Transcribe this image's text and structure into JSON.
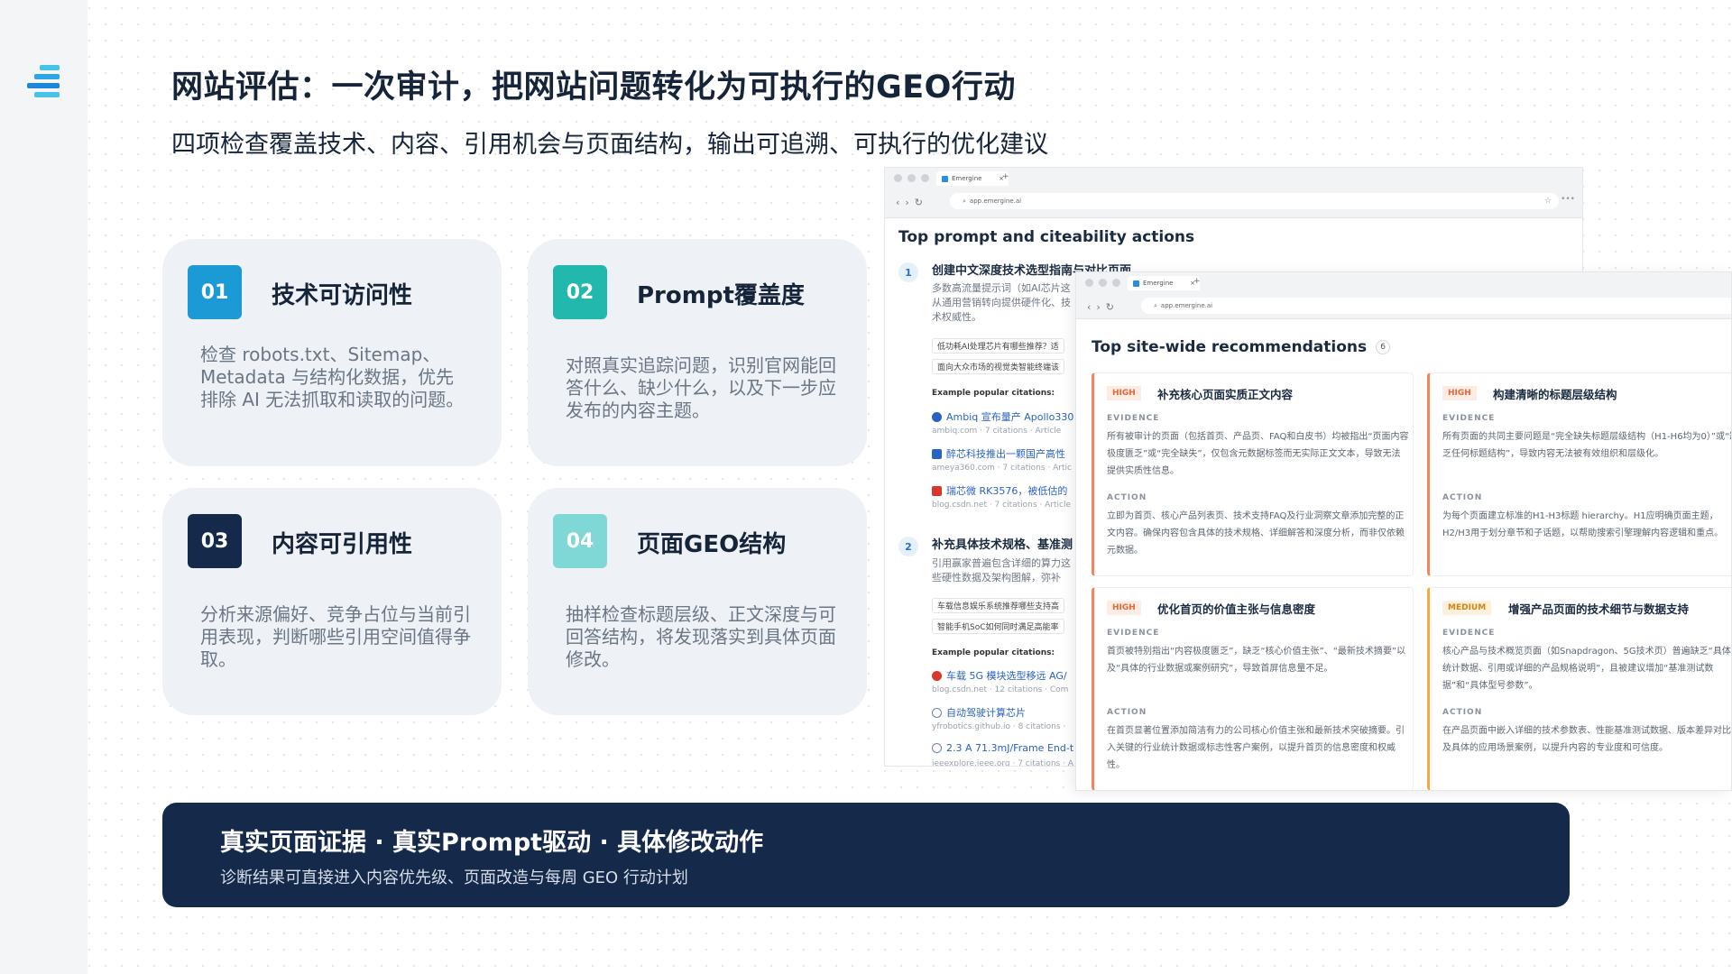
{
  "header": {
    "title": "网站评估：一次审计，把网站问题转化为可执行的GEO行动",
    "subtitle": "四项检查覆盖技术、内容、引用机会与页面结构，输出可追溯、可执行的优化建议"
  },
  "cards": [
    {
      "num": "01",
      "title": "技术可访问性",
      "desc": "检查 robots.txt、Sitemap、Metadata 与结构化数据，优先排除 AI 无法抓取和读取的问题。",
      "color": "#1b9ad6"
    },
    {
      "num": "02",
      "title": "Prompt覆盖度",
      "desc": "对照真实追踪问题，识别官网能回答什么、缺少什么，以及下一步应发布的内容主题。",
      "color": "#22b8ad"
    },
    {
      "num": "03",
      "title": "内容可引用性",
      "desc": "分析来源偏好、竞争占位与当前引用表现，判断哪些引用空间值得争取。",
      "color": "#15294a"
    },
    {
      "num": "04",
      "title": "页面GEO结构",
      "desc": "抽样检查标题层级、正文深度与可回答结构，将发现落实到具体页面修改。",
      "color": "#7fd7d6"
    }
  ],
  "browser1": {
    "tab": "Emergine",
    "url": "app.emergine.ai",
    "panel_title": "Top prompt and citeability actions",
    "items": [
      {
        "num": "1",
        "title": "创建中文深度技术选型指南与对比页面",
        "desc": "多数高流量提示词（如AI芯片这从通用营销转向提供硬件化、技术权威性。",
        "chips": [
          "低功耗AI处理芯片有哪些推荐？适",
          "面向大众市场的视觉类智能终端该"
        ],
        "label": "Example popular citations:",
        "citations": [
          {
            "title": "Ambiq 宣布量产 Apollo330",
            "meta": "ambiq.com · 7 citations · Article",
            "icon": "#2a62c4"
          },
          {
            "title": "醉芯科技推出一颗国产高性",
            "meta": "ameya360.com · 7 citations · Artic",
            "icon": "#2a62c4"
          },
          {
            "title": "瑞芯微 RK3576，被低估的",
            "meta": "blog.csdn.net · 7 citations · Article",
            "icon": "#d9372b"
          }
        ]
      },
      {
        "num": "2",
        "title": "补充具体技术规格、基准测",
        "desc": "引用赢家普遍包含详细的算力这些硬性数据及架构图解，弥补",
        "chips": [
          "车载信息娱乐系统推荐哪些支持高",
          "智能手机SoC如何同时满足高能率"
        ],
        "label": "Example popular citations:",
        "citations": [
          {
            "title": "车载 5G 模块选型移远 AG/",
            "meta": "blog.csdn.net · 12 citations · Com",
            "icon": "#d9372b"
          },
          {
            "title": "自动驾驶计算芯片",
            "meta": "yfrobotics.github.io · 8 citations ·",
            "icon": "#6e82b8"
          },
          {
            "title": "2.3 A 71.3mJ/Frame End-t",
            "meta": "ieeexplore.ieee.org · 7 citations · A",
            "icon": "#6e82b8"
          }
        ]
      }
    ]
  },
  "browser2": {
    "tab": "Emergine",
    "url": "app.emergine.ai",
    "panel_title": "Top site-wide recommendations",
    "count": "6",
    "evidence_label": "EVIDENCE",
    "action_label": "ACTION",
    "recs": [
      {
        "priority": "HIGH",
        "title": "补充核心页面实质正文内容",
        "evidence": "所有被审计的页面（包括首页、产品页、FAQ和白皮书）均被指出“页面内容极度匮乏”或“完全缺失”，仅包含元数据标签而无实际正文文本，导致无法提供实质性信息。",
        "action": "立即为首页、核心产品列表页、技术支持FAQ及行业洞察文章添加完整的正文内容。确保内容包含具体的技术规格、详细解答和深度分析，而非仅依赖元数据。"
      },
      {
        "priority": "HIGH",
        "title": "构建清晰的标题层级结构",
        "evidence": "所有页面的共同主要问题是“完全缺失标题层级结构（H1-H6均为0）”或“缺乏任何标题结构”，导致内容无法被有效组织和层级化。",
        "action": "为每个页面建立标准的H1-H3标题 hierarchy。H1应明确页面主题，H2/H3用于划分章节和子话题，以帮助搜索引擎理解内容逻辑和重点。"
      },
      {
        "priority": "HIGH",
        "title": "优化首页的价值主张与信息密度",
        "evidence": "首页被特别指出“内容极度匮乏”，缺乏“核心价值主张”、“最新技术摘要”以及“具体的行业数据或案例研究”，导致首屏信息量不足。",
        "action": "在首页显著位置添加简洁有力的公司核心价值主张和最新技术突破摘要。引入关键的行业统计数据或标志性客户案例，以提升首页的信息密度和权威性。"
      },
      {
        "priority": "MEDIUM",
        "title": "增强产品页面的技术细节与数据支持",
        "evidence": "核心产品与技术概览页面（如Snapdragon、5G技术页）普遍缺乏“具体的统计数据、引用或详细的产品规格说明”，且被建议增加“基准测试数据”和“具体型号参数”。",
        "action": "在产品页面中嵌入详细的技术参数表、性能基准测试数据、版本差异对比以及具体的应用场景案例，以提升内容的专业度和可信度。"
      }
    ]
  },
  "banner": {
    "title": "真实页面证据 · 真实Prompt驱动 · 具体修改动作",
    "subtitle": "诊断结果可直接进入内容优先级、页面改造与每周 GEO 行动计划"
  }
}
